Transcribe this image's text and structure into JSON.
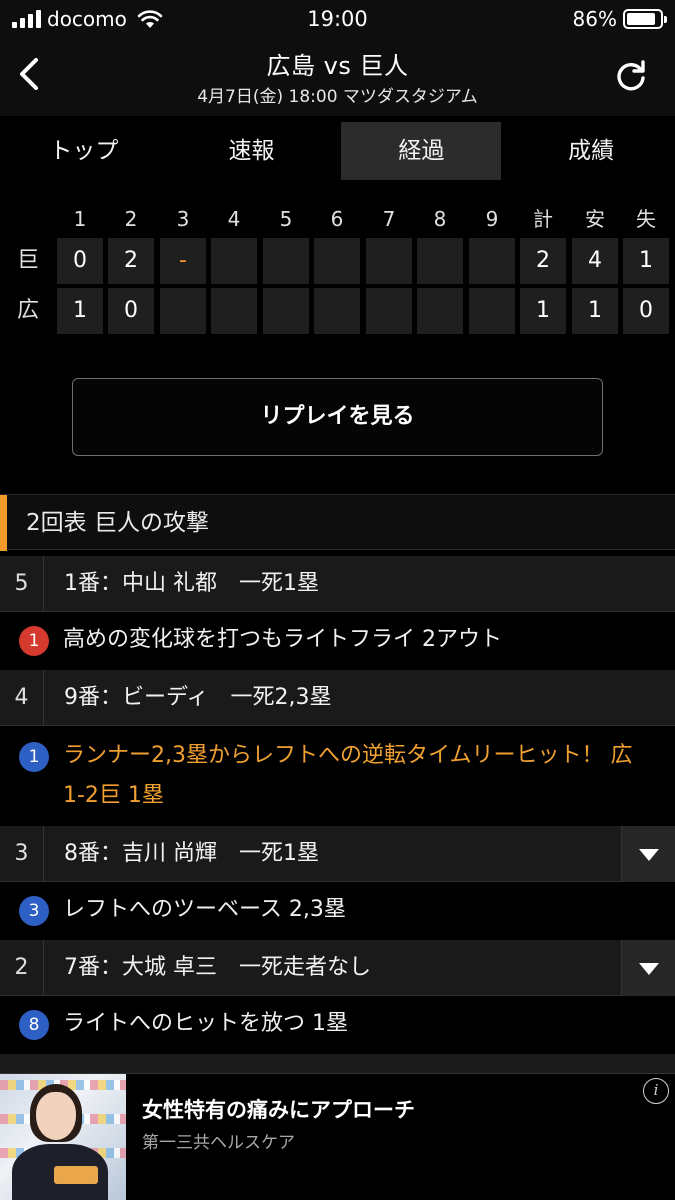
{
  "status_bar": {
    "carrier": "docomo",
    "time": "19:00",
    "battery": "86%",
    "battery_level": 0.86
  },
  "header": {
    "title": "広島 vs 巨人",
    "subtitle": "4月7日(金) 18:00 マツダスタジアム",
    "back_icon": "chevron-left-icon",
    "refresh_icon": "refresh-icon"
  },
  "tabs": [
    {
      "label": "トップ",
      "active": false
    },
    {
      "label": "速報",
      "active": false
    },
    {
      "label": "経過",
      "active": true
    },
    {
      "label": "成績",
      "active": false
    }
  ],
  "scoreboard": {
    "innings_header": [
      "1",
      "2",
      "3",
      "4",
      "5",
      "6",
      "7",
      "8",
      "9"
    ],
    "totals_header": [
      "計",
      "安",
      "失"
    ],
    "teams": [
      {
        "name": "巨",
        "innings": [
          "0",
          "2",
          "-",
          "",
          "",
          "",
          "",
          "",
          ""
        ],
        "totals": [
          "2",
          "4",
          "1"
        ]
      },
      {
        "name": "広",
        "innings": [
          "1",
          "0",
          "",
          "",
          "",
          "",
          "",
          "",
          ""
        ],
        "totals": [
          "1",
          "1",
          "0"
        ]
      }
    ],
    "live_color": "#f39a2c"
  },
  "replay_button": "リプレイを見る",
  "play_by_play": {
    "inning_header": "2回表 巨人の攻撃",
    "accent_color": "#f39a2c",
    "at_bats": [
      {
        "num": "5",
        "label": "1番：中山 礼都　一死1塁",
        "expandable": false,
        "event": {
          "badge": "1",
          "badge_color": "red",
          "text": "高めの変化球を打つもライトフライ 2アウト",
          "highlight": false
        }
      },
      {
        "num": "4",
        "label": "9番：ビーディ　一死2,3塁",
        "expandable": false,
        "event": {
          "badge": "1",
          "badge_color": "blue",
          "text": "ランナー2,3塁からレフトへの逆転タイムリーヒット！ 広1-2巨 1塁",
          "highlight": true
        }
      },
      {
        "num": "3",
        "label": "8番：吉川 尚輝　一死1塁",
        "expandable": true,
        "event": {
          "badge": "3",
          "badge_color": "blue",
          "text": "レフトへのツーベース 2,3塁",
          "highlight": false
        }
      },
      {
        "num": "2",
        "label": "7番：大城 卓三　一死走者なし",
        "expandable": true,
        "event": {
          "badge": "8",
          "badge_color": "blue",
          "text": "ライトへのヒットを放つ 1塁",
          "highlight": false
        }
      }
    ]
  },
  "ad": {
    "title": "女性特有の痛みにアプローチ",
    "sponsor": "第一三共ヘルスケア",
    "info_icon": "info-icon"
  }
}
